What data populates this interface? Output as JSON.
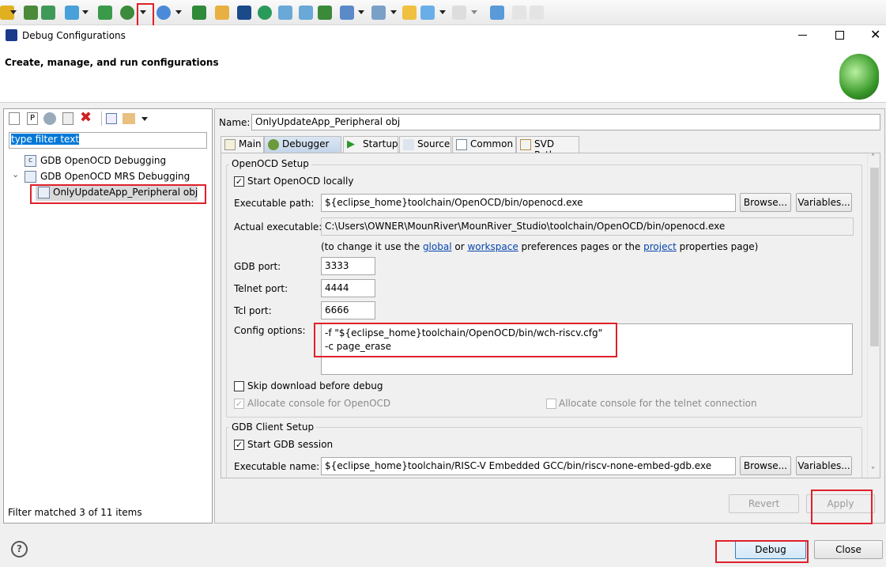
{
  "toolbar": {
    "icons": [
      "run-icon",
      "build-all-icon",
      "layers-icon",
      "download-icon",
      "console-view-icon",
      "debug-bug-icon",
      "search-icon",
      "hex-file-icon",
      "help-doc-icon",
      "terminal-icon",
      "k-icon",
      "step-into-icon",
      "step-over-icon",
      "clear-breakpoints-icon",
      "outline-icon",
      "task-icon",
      "forward-nav-icon",
      "back-icon",
      "forward-icon",
      "new-window-icon",
      "undo-icon",
      "redo-icon"
    ]
  },
  "window": {
    "title": "Debug Configurations"
  },
  "header": {
    "title": "Create, manage, and run configurations"
  },
  "left": {
    "filter_placeholder": "type filter text",
    "tree": [
      {
        "label": "GDB OpenOCD Debugging",
        "level": 0
      },
      {
        "label": "GDB OpenOCD MRS Debugging",
        "level": 0,
        "expanded": true
      },
      {
        "label": "OnlyUpdateApp_Peripheral obj",
        "level": 1,
        "selected": true
      }
    ],
    "status": "Filter matched 3 of 11 items"
  },
  "right": {
    "name_label": "Name:",
    "name_value": "OnlyUpdateApp_Peripheral obj",
    "tabs": [
      {
        "label": "Main"
      },
      {
        "label": "Debugger",
        "active": true
      },
      {
        "label": "Startup"
      },
      {
        "label": "Source"
      },
      {
        "label": "Common"
      },
      {
        "label": "SVD Path"
      }
    ],
    "openocd": {
      "group": "OpenOCD Setup",
      "start_locally": "Start OpenOCD locally",
      "exec_label": "Executable path:",
      "exec_value": "${eclipse_home}toolchain/OpenOCD/bin/openocd.exe",
      "browse": "Browse...",
      "variables": "Variables...",
      "actual_label": "Actual executable:",
      "actual_value": "C:\\Users\\OWNER\\MounRiver\\MounRiver_Studio\\toolchain/OpenOCD/bin/openocd.exe",
      "hint_pre": "(to change it use the ",
      "hint_global": "global",
      "hint_or": " or ",
      "hint_workspace": "workspace",
      "hint_mid": " preferences pages or the ",
      "hint_project": "project",
      "hint_post": " properties page)",
      "gdb_port_label": "GDB port:",
      "gdb_port": "3333",
      "telnet_port_label": "Telnet port:",
      "telnet_port": "4444",
      "tcl_port_label": "Tcl port:",
      "tcl_port": "6666",
      "config_label": "Config options:",
      "config_line1": "-f \"${eclipse_home}toolchain/OpenOCD/bin/wch-riscv.cfg\"",
      "config_line2": "-c page_erase",
      "skip_download": "Skip download before debug",
      "alloc_console": "Allocate console for OpenOCD",
      "alloc_telnet": "Allocate console for the telnet connection"
    },
    "gdb": {
      "group": "GDB Client Setup",
      "start_session": "Start GDB session",
      "exec_label": "Executable name:",
      "exec_value": "${eclipse_home}toolchain/RISC-V Embedded GCC/bin/riscv-none-embed-gdb.exe",
      "browse": "Browse...",
      "variables": "Variables..."
    },
    "revert": "Revert",
    "apply": "Apply"
  },
  "footer": {
    "debug": "Debug",
    "close": "Close"
  },
  "colors": {
    "highlight": "#e0202a",
    "selection": "#0078d7"
  }
}
